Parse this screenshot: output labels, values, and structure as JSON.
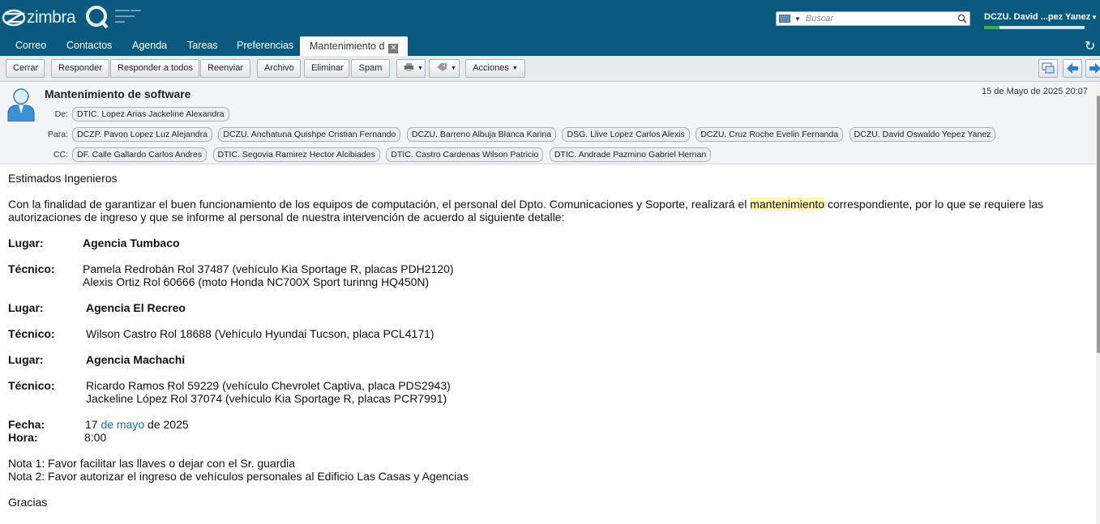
{
  "header": {
    "logo_text": "zimbra",
    "search_placeholder": "Buscar",
    "user_name": "DCZU. David ...pez Yanez",
    "quota_fraction": 0.15
  },
  "tabs": [
    {
      "label": "Correo"
    },
    {
      "label": "Contactos"
    },
    {
      "label": "Agenda"
    },
    {
      "label": "Tareas"
    },
    {
      "label": "Preferencias"
    },
    {
      "label": "Mantenimiento d",
      "active": true
    }
  ],
  "toolbar": {
    "close": "Cerrar",
    "reply": "Responder",
    "reply_all": "Responder a todos",
    "forward": "Reenviar",
    "archive": "Archivo",
    "delete": "Eliminar",
    "spam": "Spam",
    "actions": "Acciones"
  },
  "message": {
    "subject": "Mantenimiento de software",
    "date": "15 de Mayo de 2025 20:07",
    "from_label": "De:",
    "from": [
      "DTIC. Lopez Arias Jackeline Alexandra"
    ],
    "to_label": "Para:",
    "to": [
      "DCZP. Pavon Lopez Luz Alejandra",
      "DCZU. Anchatuna Quishpe Cristian Fernando",
      "DCZU. Barreno Albuja Blanca Karina",
      "DSG. Llive Lopez Carlos Alexis",
      "DCZU. Cruz Roche Evelin Fernanda",
      "DCZU. David Oswaldo Yepez Yanez"
    ],
    "cc_label": "CC:",
    "cc": [
      "DF. Calle Gallardo Carlos Andres",
      "DTIC. Segovia Ramirez Hector Alcibiades",
      "DTIC. Castro Cardenas Wilson Patricio",
      "DTIC. Andrade Pazmino Gabriel Hernan"
    ]
  },
  "body": {
    "greeting": "Estimados Ingenieros",
    "intro_before": "Con la finalidad de garantizar el buen funcionamiento de los equipos de computación, el personal del Dpto. Comunicaciones y Soporte, realizará el ",
    "intro_highlight": "mantenimiento",
    "intro_after": " correspondiente, por lo que se requiere las autorizaciones de ingreso y que se informe al personal de nuestra intervención de acuerdo al siguiente detalle:",
    "lugar_label": "Lugar:",
    "tecnico_label": "Técnico:",
    "lugar1": "Agencia Tumbaco",
    "tec1a": "Pamela Redrobán Rol 37487 (vehículo Kia Sportage R, placas PDH2120)",
    "tec1b": "Alexis Ortiz Rol 60666 (moto Honda NC700X Sport turinng HQ450N)",
    "lugar2": "Agencia El Recreo",
    "tec2": "Wilson Castro Rol 18688  (Vehículo Hyundai Tucson, placa PCL4171)",
    "lugar3": "Agencia Machachi",
    "tec3a": "Ricardo Ramos Rol 59229 (vehículo Chevrolet Captiva, placa PDS2943)",
    "tec3b": "Jackeline López Rol 37074 (vehículo Kia Sportage R, placas PCR7991)",
    "fecha_label": "Fecha:",
    "fecha_day": "17 ",
    "fecha_link": "de mayo",
    "fecha_year": " de 2025",
    "hora_label": "Hora:",
    "hora": "8:00",
    "nota1": "Nota 1: Favor facilitar las llaves o dejar con el Sr. guardia",
    "nota2": "Nota 2: Favor autorizar el ingreso de vehículos personales al Edificio Las Casas y Agencias",
    "closing": "Gracias"
  }
}
